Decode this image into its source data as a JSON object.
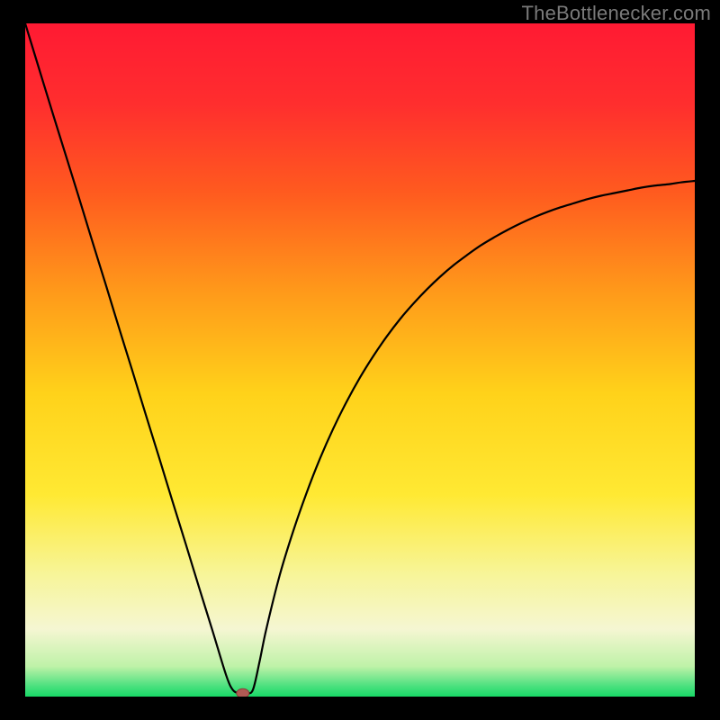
{
  "attribution": "TheBottlenecker.com",
  "colors": {
    "background": "#000000",
    "gradient_stops": [
      {
        "offset": 0.0,
        "color": "#ff1a33"
      },
      {
        "offset": 0.12,
        "color": "#ff2e2e"
      },
      {
        "offset": 0.25,
        "color": "#ff5a1f"
      },
      {
        "offset": 0.4,
        "color": "#ff9a1a"
      },
      {
        "offset": 0.55,
        "color": "#ffd21a"
      },
      {
        "offset": 0.7,
        "color": "#ffe933"
      },
      {
        "offset": 0.82,
        "color": "#f7f59a"
      },
      {
        "offset": 0.9,
        "color": "#f5f6d2"
      },
      {
        "offset": 0.955,
        "color": "#bff2a8"
      },
      {
        "offset": 0.985,
        "color": "#49e07e"
      },
      {
        "offset": 1.0,
        "color": "#18d966"
      }
    ],
    "curve": "#000000",
    "marker_fill": "#b25a54",
    "marker_stroke": "#8a3d38"
  },
  "chart_data": {
    "type": "line",
    "title": "",
    "xlabel": "",
    "ylabel": "",
    "xlim": [
      0,
      100
    ],
    "ylim": [
      0,
      100
    ],
    "x": [
      0,
      2,
      4,
      6,
      8,
      10,
      12,
      14,
      16,
      18,
      20,
      22,
      24,
      26,
      28,
      30,
      31,
      32,
      33,
      34,
      35,
      36,
      38,
      40,
      42,
      44,
      46,
      48,
      50,
      52,
      54,
      56,
      58,
      60,
      62,
      64,
      66,
      68,
      70,
      72,
      74,
      76,
      78,
      80,
      82,
      84,
      86,
      88,
      90,
      92,
      94,
      96,
      98,
      100
    ],
    "values": [
      100,
      93.5,
      87,
      80.6,
      74.2,
      67.7,
      61.3,
      54.8,
      48.4,
      41.9,
      35.5,
      29.0,
      22.6,
      16.1,
      9.7,
      3.2,
      1.0,
      0.5,
      0.5,
      1.0,
      5.2,
      10.0,
      18.0,
      24.5,
      30.2,
      35.3,
      39.8,
      43.8,
      47.4,
      50.6,
      53.5,
      56.1,
      58.4,
      60.5,
      62.4,
      64.1,
      65.6,
      67.0,
      68.2,
      69.3,
      70.3,
      71.2,
      72.0,
      72.7,
      73.3,
      73.9,
      74.4,
      74.8,
      75.2,
      75.6,
      75.9,
      76.1,
      76.4,
      76.6
    ],
    "marker": {
      "x": 32.5,
      "y": 0.5
    },
    "notes": "y represents bottleneck percentage (higher = more red); curve dips to ~0 near x≈32 then rises toward ~77."
  }
}
